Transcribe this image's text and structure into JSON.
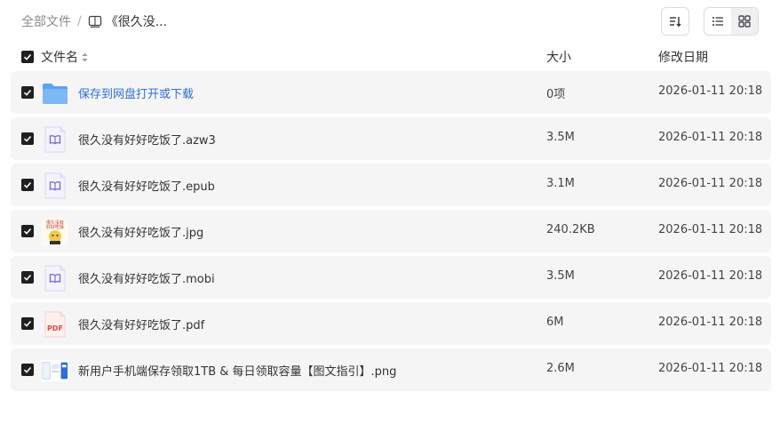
{
  "breadcrumb": {
    "root": "全部文件",
    "separator": "/",
    "current": "《很久没..."
  },
  "header": {
    "name": "文件名",
    "size": "大小",
    "date": "修改日期"
  },
  "files": [
    {
      "name": "保存到网盘打开或下载",
      "size": "0项",
      "date": "2026-01-11 20:18",
      "type": "folder",
      "checked": true
    },
    {
      "name": "很久没有好好吃饭了.azw3",
      "size": "3.5M",
      "date": "2026-01-11 20:18",
      "type": "ebook",
      "checked": true
    },
    {
      "name": "很久没有好好吃饭了.epub",
      "size": "3.1M",
      "date": "2026-01-11 20:18",
      "type": "ebook",
      "checked": true
    },
    {
      "name": "很久没有好好吃饭了.jpg",
      "size": "240.2KB",
      "date": "2026-01-11 20:18",
      "type": "image",
      "checked": true
    },
    {
      "name": "很久没有好好吃饭了.mobi",
      "size": "3.5M",
      "date": "2026-01-11 20:18",
      "type": "ebook",
      "checked": true
    },
    {
      "name": "很久没有好好吃饭了.pdf",
      "size": "6M",
      "date": "2026-01-11 20:18",
      "type": "pdf",
      "checked": true
    },
    {
      "name": "新用户手机端保存领取1TB & 每日领取容量【图文指引】.png",
      "size": "2.6M",
      "date": "2026-01-11 20:18",
      "type": "screenshot",
      "checked": true
    }
  ],
  "icons": {
    "pdf_label": "PDF",
    "cover_text": "很久没有好好吃饭了"
  },
  "colors": {
    "folder_blue": "#2f6fd1",
    "ebook_purple": "#7b6fd6",
    "pdf_red": "#e5483d"
  }
}
